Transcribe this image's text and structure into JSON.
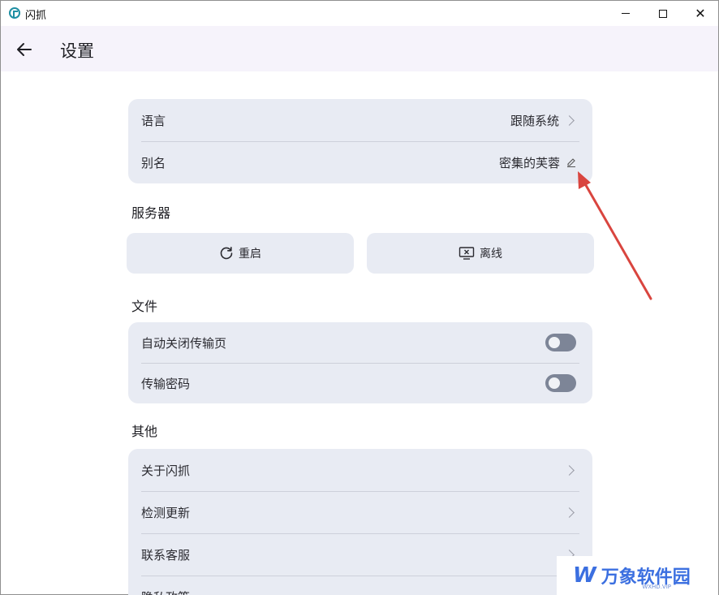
{
  "window": {
    "title": "闪抓",
    "minimize_icon": "minimize-icon",
    "maximize_icon": "maximize-icon",
    "close_glyph": "✕"
  },
  "header": {
    "title": "设置",
    "back_icon": "arrow-left-icon"
  },
  "general": {
    "language_label": "语言",
    "language_value": "跟随系统",
    "alias_label": "别名",
    "alias_value": "密集的芙蓉"
  },
  "server": {
    "section_title": "服务器",
    "restart_label": "重启",
    "offline_label": "离线"
  },
  "files": {
    "section_title": "文件",
    "auto_close_label": "自动关闭传输页",
    "auto_close_on": false,
    "password_label": "传输密码",
    "password_on": false
  },
  "other": {
    "section_title": "其他",
    "items": [
      {
        "label": "关于闪抓"
      },
      {
        "label": "检测更新"
      },
      {
        "label": "联系客服"
      },
      {
        "label": "隐私政策"
      }
    ]
  },
  "annotation": {
    "arrow_color": "#d9453f"
  },
  "watermark": {
    "logo": "W",
    "text": "万象软件园",
    "sub": "WXHD.VIP"
  },
  "colors": {
    "card_bg": "#e8ebf3",
    "header_bg": "#f6f3fb",
    "toggle_off": "#7d8597"
  }
}
